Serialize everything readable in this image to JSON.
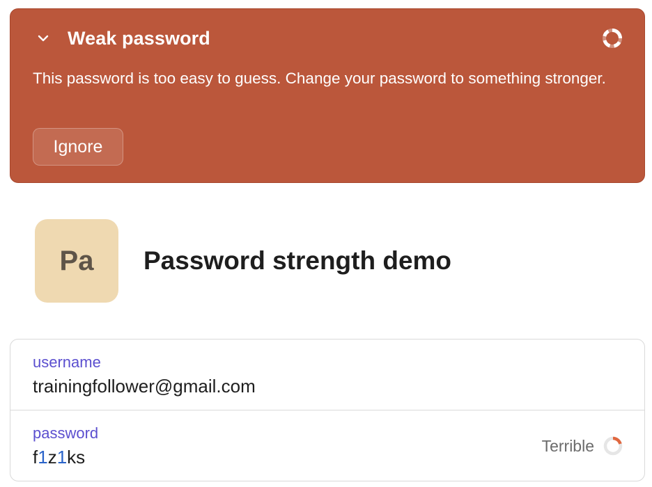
{
  "alert": {
    "title": "Weak password",
    "message": "This password is too easy to guess. Change your password to something stronger.",
    "ignore_label": "Ignore",
    "icons": {
      "collapse": "chevron-down-icon",
      "status": "strength-ring-icon"
    },
    "background_color": "#bb573b"
  },
  "item": {
    "avatar_text": "Pa",
    "title": "Password strength demo",
    "avatar_color": "#efd9b1"
  },
  "fields": {
    "username": {
      "label": "username",
      "value": "trainingfollower@gmail.com"
    },
    "password": {
      "label": "password",
      "value": "f1z1ks",
      "strength_label": "Terrible",
      "strength_color": "#e0673f"
    }
  },
  "colors": {
    "field_label": "#5b4fcf",
    "password_digit": "#2a63c9"
  }
}
